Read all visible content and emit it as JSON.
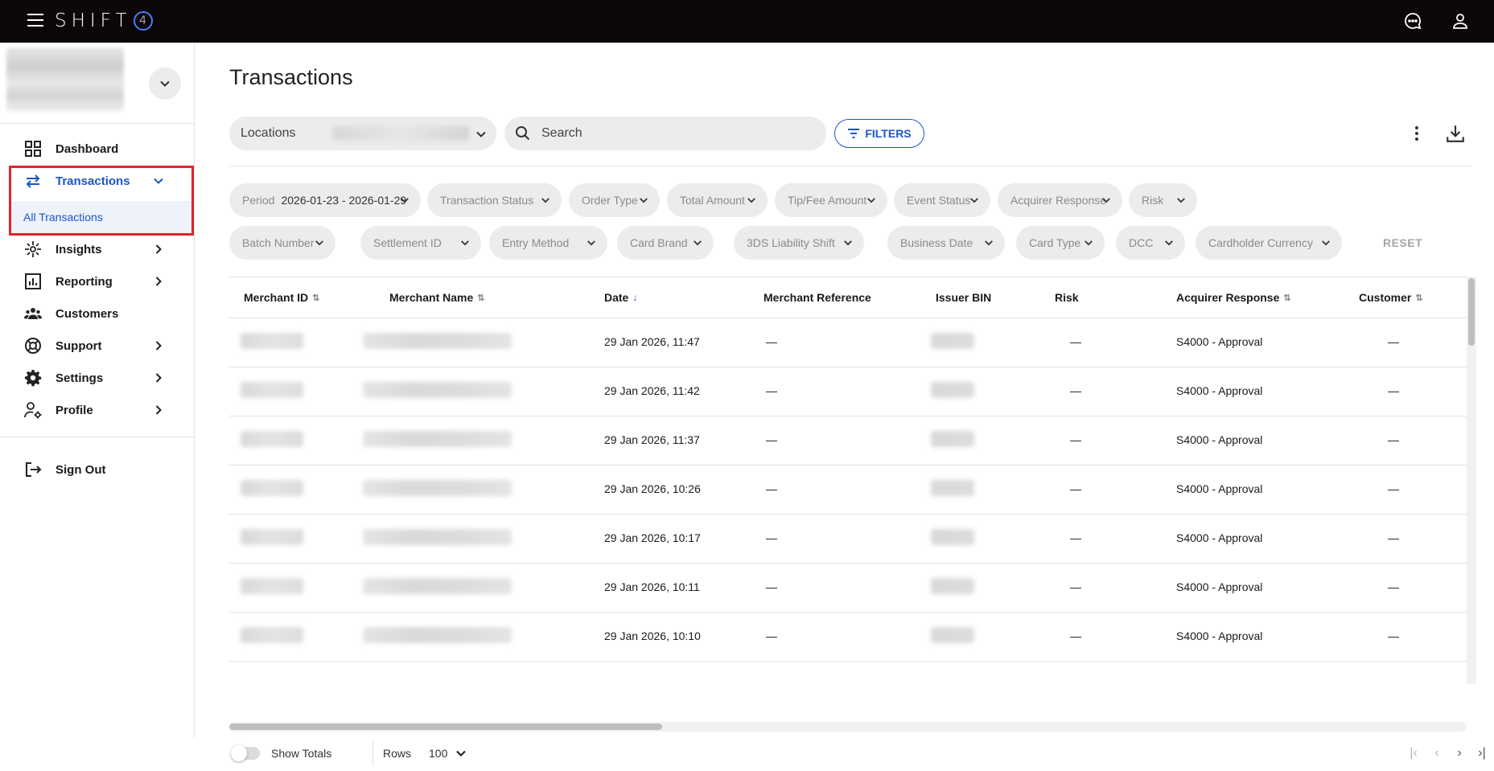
{
  "brand": {
    "name": "SHIFT",
    "mark": "4"
  },
  "sidebar": {
    "items": [
      {
        "key": "dashboard",
        "label": "Dashboard",
        "icon": "grid-icon"
      },
      {
        "key": "transactions",
        "label": "Transactions",
        "icon": "swap-arrows-icon"
      },
      {
        "key": "insights",
        "label": "Insights",
        "icon": "sparkle-icon"
      },
      {
        "key": "reporting",
        "label": "Reporting",
        "icon": "bar-chart-icon"
      },
      {
        "key": "customers",
        "label": "Customers",
        "icon": "people-icon"
      },
      {
        "key": "support",
        "label": "Support",
        "icon": "lifebuoy-icon"
      },
      {
        "key": "settings",
        "label": "Settings",
        "icon": "gear-icon"
      },
      {
        "key": "profile",
        "label": "Profile",
        "icon": "user-gear-icon"
      }
    ],
    "sub_item": "All Transactions",
    "signout": "Sign Out"
  },
  "main": {
    "title": "Transactions",
    "locations_label": "Locations",
    "search_placeholder": "Search",
    "filters_label": "FILTERS",
    "reset_label": "RESET"
  },
  "filters": {
    "period_label": "Period",
    "period_value": "2026-01-23 - 2026-01-29",
    "row1": [
      "Transaction Status",
      "Order Type",
      "Total Amount",
      "Tip/Fee Amount",
      "Event Status",
      "Acquirer Response",
      "Risk"
    ],
    "row2": [
      "Batch Number",
      "Settlement ID",
      "Entry Method",
      "Card Brand",
      "3DS Liability Shift",
      "Business Date",
      "Card Type",
      "DCC",
      "Cardholder Currency"
    ]
  },
  "table": {
    "columns": [
      "Merchant ID",
      "Merchant Name",
      "Date",
      "Merchant Reference",
      "Issuer BIN",
      "Risk",
      "Acquirer Response",
      "Customer"
    ],
    "rows": [
      {
        "date": "29 Jan 2026, 11:47",
        "ref": "—",
        "risk": "—",
        "acq": "S4000 - Approval",
        "customer": "—"
      },
      {
        "date": "29 Jan 2026, 11:42",
        "ref": "—",
        "risk": "—",
        "acq": "S4000 - Approval",
        "customer": "—"
      },
      {
        "date": "29 Jan 2026, 11:37",
        "ref": "—",
        "risk": "—",
        "acq": "S4000 - Approval",
        "customer": "—"
      },
      {
        "date": "29 Jan 2026, 10:26",
        "ref": "—",
        "risk": "—",
        "acq": "S4000 - Approval",
        "customer": "—"
      },
      {
        "date": "29 Jan 2026, 10:17",
        "ref": "—",
        "risk": "—",
        "acq": "S4000 - Approval",
        "customer": "—"
      },
      {
        "date": "29 Jan 2026, 10:11",
        "ref": "—",
        "risk": "—",
        "acq": "S4000 - Approval",
        "customer": "—"
      },
      {
        "date": "29 Jan 2026, 10:10",
        "ref": "—",
        "risk": "—",
        "acq": "S4000 - Approval",
        "customer": "—"
      }
    ]
  },
  "footer": {
    "show_totals": "Show Totals",
    "rows_label": "Rows",
    "rows_value": "100"
  },
  "colors": {
    "accent": "#1a56c4",
    "topbar": "#0b0708",
    "highlight": "#e0242c"
  }
}
